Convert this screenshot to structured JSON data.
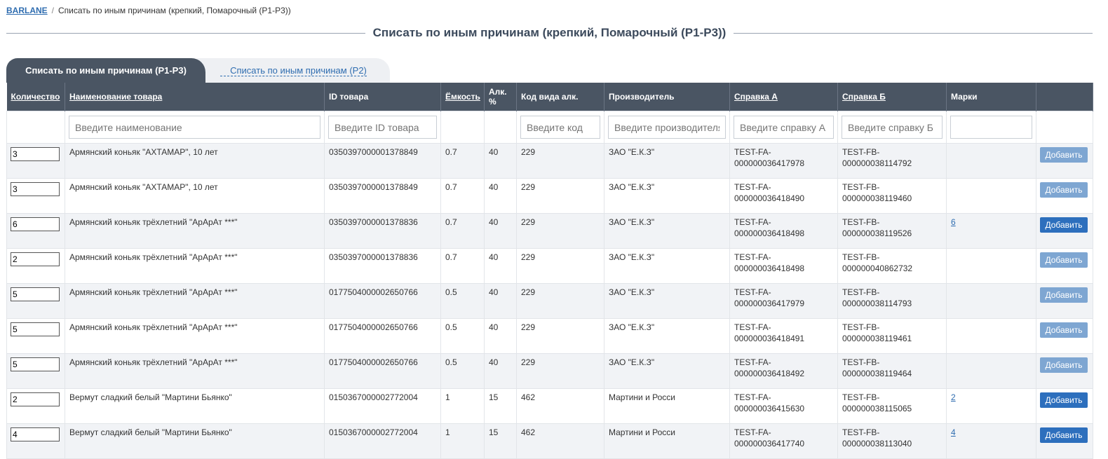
{
  "breadcrumb": {
    "home": "BARLANE",
    "separator": "/",
    "current": "Списать по иным причинам (крепкий, Помарочный (P1-P3))"
  },
  "page_title": "Списать по иным причинам (крепкий, Помарочный (P1-P3))",
  "tabs": [
    {
      "label": "Списать по иным причинам (P1-P3)",
      "active": true
    },
    {
      "label": "Списать по иным причинам (P2)",
      "active": false
    }
  ],
  "columns": {
    "qty": "Количество",
    "name": "Наименование товара",
    "id": "ID товара",
    "volume": "Ёмкость",
    "alc": "Алк. %",
    "code": "Код вида алк.",
    "producer": "Производитель",
    "ref_a": "Справка А",
    "ref_b": "Справка Б",
    "marks": "Марки"
  },
  "filters": {
    "name_placeholder": "Введите наименование",
    "id_placeholder": "Введите ID товара",
    "code_placeholder": "Введите код",
    "producer_placeholder": "Введите производителя",
    "ref_a_placeholder": "Введите справку А",
    "ref_b_placeholder": "Введите справку Б",
    "marks_placeholder": ""
  },
  "add_label": "Добавить",
  "rows": [
    {
      "qty": "3",
      "name": "Армянский коньяк \"АХТАМАР\", 10 лет",
      "id": "0350397000001378849",
      "volume": "0.7",
      "alc": "40",
      "code": "229",
      "producer": "ЗАО \"Е.К.З\"",
      "ref_a_1": "TEST-FA-",
      "ref_a_2": "000000036417978",
      "ref_b_1": "TEST-FB-",
      "ref_b_2": "000000038114792",
      "marks": "",
      "active": false
    },
    {
      "qty": "3",
      "name": "Армянский коньяк \"АХТАМАР\", 10 лет",
      "id": "0350397000001378849",
      "volume": "0.7",
      "alc": "40",
      "code": "229",
      "producer": "ЗАО \"Е.К.З\"",
      "ref_a_1": "TEST-FA-",
      "ref_a_2": "000000036418490",
      "ref_b_1": "TEST-FB-",
      "ref_b_2": "000000038119460",
      "marks": "",
      "active": false
    },
    {
      "qty": "6",
      "name": "Армянский коньяк трёхлетний \"АрАрАт ***\"",
      "id": "0350397000001378836",
      "volume": "0.7",
      "alc": "40",
      "code": "229",
      "producer": "ЗАО \"Е.К.З\"",
      "ref_a_1": "TEST-FA-",
      "ref_a_2": "000000036418498",
      "ref_b_1": "TEST-FB-",
      "ref_b_2": "000000038119526",
      "marks": "6",
      "active": true
    },
    {
      "qty": "2",
      "name": "Армянский коньяк трёхлетний \"АрАрАт ***\"",
      "id": "0350397000001378836",
      "volume": "0.7",
      "alc": "40",
      "code": "229",
      "producer": "ЗАО \"Е.К.З\"",
      "ref_a_1": "TEST-FA-",
      "ref_a_2": "000000036418498",
      "ref_b_1": "TEST-FB-",
      "ref_b_2": "000000040862732",
      "marks": "",
      "active": false
    },
    {
      "qty": "5",
      "name": "Армянский коньяк трёхлетний \"АрАрАт ***\"",
      "id": "0177504000002650766",
      "volume": "0.5",
      "alc": "40",
      "code": "229",
      "producer": "ЗАО \"Е.К.З\"",
      "ref_a_1": "TEST-FA-",
      "ref_a_2": "000000036417979",
      "ref_b_1": "TEST-FB-",
      "ref_b_2": "000000038114793",
      "marks": "",
      "active": false
    },
    {
      "qty": "5",
      "name": "Армянский коньяк трёхлетний \"АрАрАт ***\"",
      "id": "0177504000002650766",
      "volume": "0.5",
      "alc": "40",
      "code": "229",
      "producer": "ЗАО \"Е.К.З\"",
      "ref_a_1": "TEST-FA-",
      "ref_a_2": "000000036418491",
      "ref_b_1": "TEST-FB-",
      "ref_b_2": "000000038119461",
      "marks": "",
      "active": false
    },
    {
      "qty": "5",
      "name": "Армянский коньяк трёхлетний \"АрАрАт ***\"",
      "id": "0177504000002650766",
      "volume": "0.5",
      "alc": "40",
      "code": "229",
      "producer": "ЗАО \"Е.К.З\"",
      "ref_a_1": "TEST-FA-",
      "ref_a_2": "000000036418492",
      "ref_b_1": "TEST-FB-",
      "ref_b_2": "000000038119464",
      "marks": "",
      "active": false
    },
    {
      "qty": "2",
      "name": "Вермут сладкий белый \"Мартини Бьянко\"",
      "id": "0150367000002772004",
      "volume": "1",
      "alc": "15",
      "code": "462",
      "producer": "Мартини и Росси",
      "ref_a_1": "TEST-FA-",
      "ref_a_2": "000000036415630",
      "ref_b_1": "TEST-FB-",
      "ref_b_2": "000000038115065",
      "marks": "2",
      "active": true
    },
    {
      "qty": "4",
      "name": "Вермут сладкий белый \"Мартини Бьянко\"",
      "id": "0150367000002772004",
      "volume": "1",
      "alc": "15",
      "code": "462",
      "producer": "Мартини и Росси",
      "ref_a_1": "TEST-FA-",
      "ref_a_2": "000000036417740",
      "ref_b_1": "TEST-FB-",
      "ref_b_2": "000000038113040",
      "marks": "4",
      "active": true
    }
  ]
}
